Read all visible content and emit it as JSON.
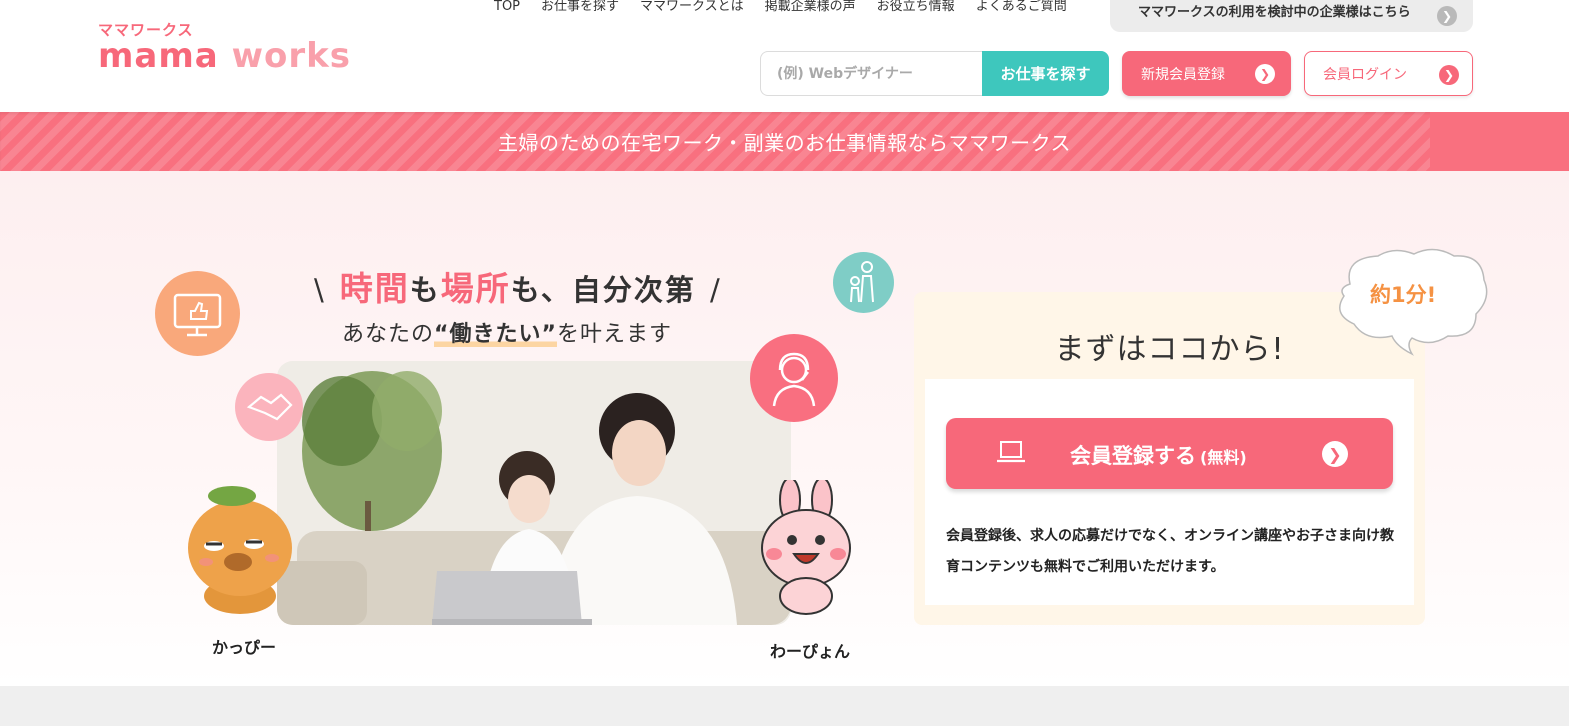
{
  "logo": {
    "kana": "ママワークス",
    "name_part1": "mama",
    "name_part2": "works"
  },
  "topnav": [
    "TOP",
    "お仕事を探す",
    "ママワークスとは",
    "掲載企業様の声",
    "お役立ち情報",
    "よくあるご質問"
  ],
  "business_link": {
    "label": "ママワークスの利用を検討中の企業様はこちら"
  },
  "search": {
    "placeholder": "(例) Webデザイナー",
    "value": "",
    "button": "お仕事を探す"
  },
  "register_button": "新規会員登録",
  "login_button": "会員ログイン",
  "banner": "主婦のための在宅ワーク・副業のお仕事情報ならママワークス",
  "hero": {
    "headline_time": "時間",
    "headline_mo1": "も",
    "headline_place": "場所",
    "headline_rest": "も、自分次第",
    "subhead_pre": "あなたの",
    "subhead_quote": "“働きたい”",
    "subhead_post": "を叶えます",
    "char_left": "かっぴー",
    "char_right": "わーぴょん"
  },
  "cta": {
    "bubble": "約1分!",
    "title": "まずはココから!",
    "button_label": "会員登録する",
    "button_note": "(無料)",
    "description": "会員登録後、求人の応募だけでなく、オンライン講座やお子さま向け教育コンテンツも無料でご利用いただけます。"
  },
  "colors": {
    "brand_pink": "#f7687a",
    "teal": "#3ec7bd",
    "orange": "#f59243"
  },
  "icons": [
    "chevron-right-icon",
    "laptop-icon",
    "monitor-thumbs-up-icon",
    "handshake-icon",
    "family-icon",
    "operator-headset-icon"
  ]
}
